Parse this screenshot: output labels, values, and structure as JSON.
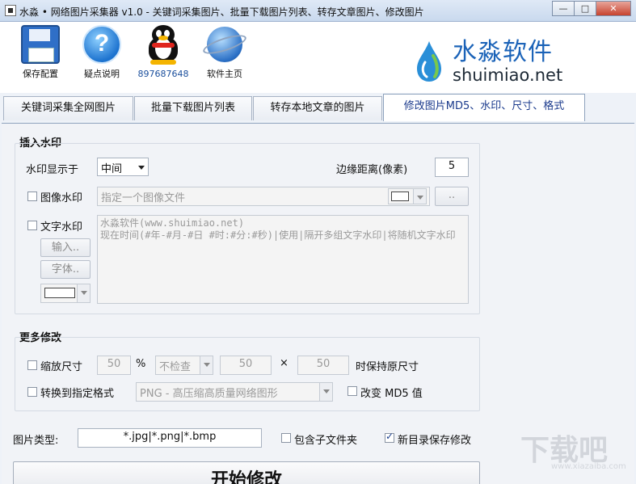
{
  "window": {
    "title": "水淼 • 网络图片采集器 v1.0 - 关键词采集图片、批量下载图片列表、转存文章图片、修改图片",
    "btn_minimize": "—",
    "btn_maximize": "□",
    "btn_close": "✕"
  },
  "toolbar": {
    "save_config": "保存配置",
    "help": "疑点说明",
    "qq": "897687648",
    "homepage": "软件主页"
  },
  "brand": {
    "name_cn": "水淼软件",
    "name_en": "shuimiao.net"
  },
  "tabs": [
    {
      "label": "关键词采集全网图片"
    },
    {
      "label": "批量下载图片列表"
    },
    {
      "label": "转存本地文章的图片"
    },
    {
      "label": "修改图片MD5、水印、尺寸、格式"
    }
  ],
  "watermark_group": {
    "title": "插入水印",
    "position_label": "水印显示于",
    "position_value": "中间",
    "margin_label": "边缘距离(像素)",
    "margin_value": "5",
    "image_wm_label": "图像水印",
    "image_file_placeholder": "指定一个图像文件",
    "browse_label": "..",
    "text_wm_label": "文字水印",
    "input_button": "输入..",
    "font_button": "字体..",
    "text_value": "水淼软件(www.shuimiao.net)\n现在时间(#年-#月-#日 #时:#分:#秒)|使用|隔开多组文字水印|将随机文字水印"
  },
  "more_group": {
    "title": "更多修改",
    "resize_label": "缩放尺寸",
    "resize_percent": "50",
    "percent_sign": "%",
    "check_mode": "不检查",
    "width_value": "50",
    "times_sign": "×",
    "height_value": "50",
    "keep_original_label": "时保持原尺寸",
    "convert_label": "转换到指定格式",
    "format_value": "PNG -  高压缩高质量网络图形",
    "change_md5_label": "改变 MD5 值"
  },
  "bottom": {
    "image_type_label": "图片类型:",
    "image_type_value": "*.jpg|*.png|*.bmp",
    "subfolder_label": "包含子文件夹",
    "new_dir_label": "新目录保存修改",
    "start_button": "开始修改"
  },
  "site_watermark": {
    "text": "下载吧",
    "sub": "www.xiazaiba.com"
  }
}
